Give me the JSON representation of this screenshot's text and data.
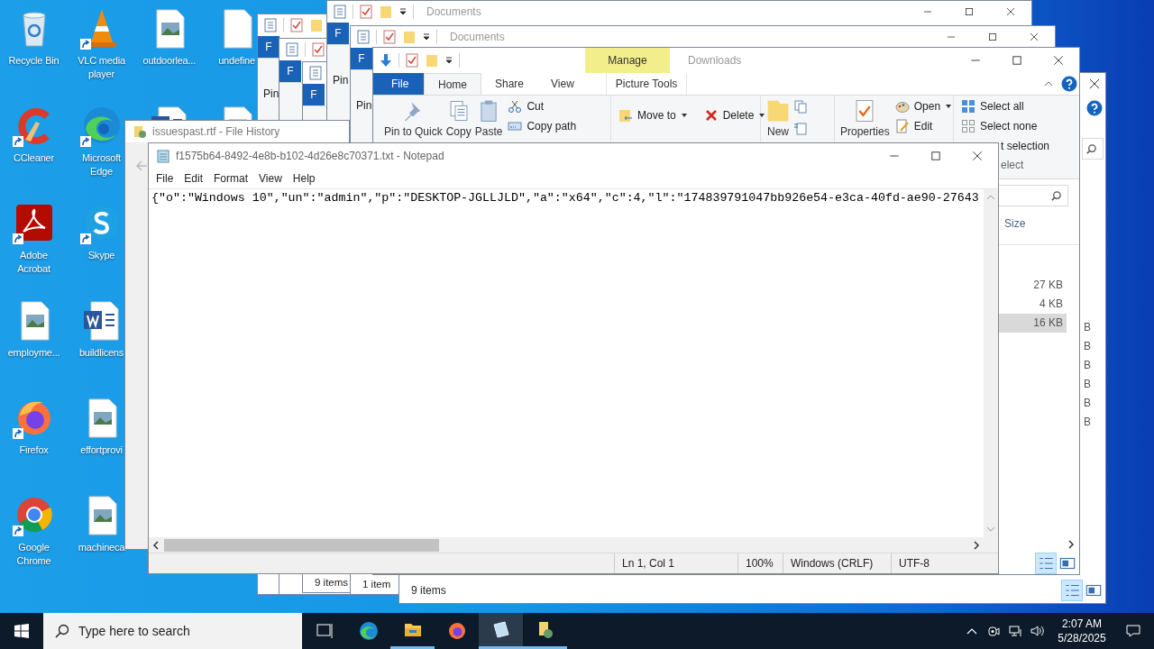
{
  "desktop_columns": [
    [
      {
        "label": "Recycle Bin",
        "kind": "recycle"
      },
      {
        "label": "CCleaner",
        "kind": "ccleaner",
        "shortcut": true
      },
      {
        "label": "Adobe Acrobat",
        "kind": "acrobat",
        "shortcut": true
      },
      {
        "label": "employme...",
        "kind": "image"
      },
      {
        "label": "Firefox",
        "kind": "firefox",
        "shortcut": true
      },
      {
        "label": "Google Chrome",
        "kind": "chrome",
        "shortcut": true
      }
    ],
    [
      {
        "label": "VLC media player",
        "kind": "vlc",
        "shortcut": true
      },
      {
        "label": "Microsoft Edge",
        "kind": "edge",
        "shortcut": true
      },
      {
        "label": "Skype",
        "kind": "skype",
        "shortcut": true
      },
      {
        "label": "buildlicens",
        "kind": "word"
      },
      {
        "label": "effortprovi",
        "kind": "image"
      },
      {
        "label": "machineca",
        "kind": "image"
      }
    ],
    [
      {
        "label": "outdoorlea...",
        "kind": "image"
      },
      {
        "kind": "word"
      }
    ],
    [
      {
        "label": "undefine",
        "kind": "blank"
      },
      {
        "kind": "text"
      }
    ]
  ],
  "back_windows": [
    {
      "file_tab": "F",
      "ribbon_text": "Pin"
    },
    {
      "file_tab": "F"
    },
    {
      "file_tab": "F",
      "status": "9 items"
    },
    {
      "title": "Documents",
      "file_tab": "F",
      "ribbon_text": "Pin"
    },
    {
      "title": "Documents",
      "file_tab": "F",
      "ribbon_text": "Pin",
      "status": "1 item"
    }
  ],
  "rear_explorer": {
    "sizes": [
      "B",
      "B",
      "B",
      "B",
      "B",
      "B"
    ],
    "status": "9 items"
  },
  "explorer": {
    "title": "Downloads",
    "context_tab": "Manage",
    "context_group": "Picture Tools",
    "tabs": [
      {
        "label": "File",
        "kind": "file",
        "selected": false
      },
      {
        "label": "Home",
        "kind": "tab",
        "selected": true
      },
      {
        "label": "Share",
        "kind": "tab",
        "selected": false
      },
      {
        "label": "View",
        "kind": "tab",
        "selected": false
      }
    ],
    "clipboard": {
      "large": [
        {
          "label": "Pin to Quick",
          "kind": "pin"
        },
        {
          "label": "Copy",
          "kind": "copy"
        },
        {
          "label": "Paste",
          "kind": "paste"
        }
      ],
      "small": [
        {
          "label": "Cut",
          "kind": "cut"
        },
        {
          "label": "Copy path",
          "kind": "path"
        }
      ]
    },
    "organize": [
      {
        "label": "Move to",
        "kind": "move",
        "menu": true
      },
      {
        "label": "Delete",
        "kind": "delete",
        "menu": true
      }
    ],
    "new_label": "New",
    "properties_label": "Properties",
    "open": [
      {
        "label": "Open",
        "kind": "open",
        "menu": true
      },
      {
        "label": "Edit",
        "kind": "edit",
        "menu": false
      }
    ],
    "select": [
      {
        "label": "Select all",
        "kind": "all"
      },
      {
        "label": "Select none",
        "kind": "none"
      },
      {
        "label": "t selection",
        "kind": "invert"
      }
    ],
    "select_group": "elect",
    "size_header": "Size",
    "rows": [
      {
        "size": "27 KB",
        "selected": false
      },
      {
        "size": "4 KB",
        "selected": false
      },
      {
        "size": "16 KB",
        "selected": true
      }
    ]
  },
  "file_history": {
    "title": "issuespast.rtf - File History"
  },
  "notepad": {
    "title": "f1575b64-8492-4e8b-b102-4d26e8c70371.txt - Notepad",
    "menu": [
      "File",
      "Edit",
      "Format",
      "View",
      "Help"
    ],
    "text": "{\"o\":\"Windows 10\",\"un\":\"admin\",\"p\":\"DESKTOP-JGLLJLD\",\"a\":\"x64\",\"c\":4,\"l\":\"174839791047bb926e54-e3ca-40fd-ae90-27643",
    "status": [
      "Ln 1, Col 1",
      "100%",
      "Windows (CRLF)",
      "UTF-8"
    ]
  },
  "taskbar": {
    "search_placeholder": "Type here to search",
    "apps": [
      {
        "kind": "taskview",
        "running": false,
        "selected": false
      },
      {
        "kind": "edge",
        "running": false,
        "selected": false
      },
      {
        "kind": "explorer",
        "running": true,
        "selected": false
      },
      {
        "kind": "firefox",
        "running": false,
        "selected": false
      },
      {
        "kind": "notepad",
        "running": true,
        "selected": true
      },
      {
        "kind": "filehistory",
        "running": true,
        "selected": false
      }
    ],
    "time": "2:07 AM",
    "date": "5/28/2025"
  }
}
